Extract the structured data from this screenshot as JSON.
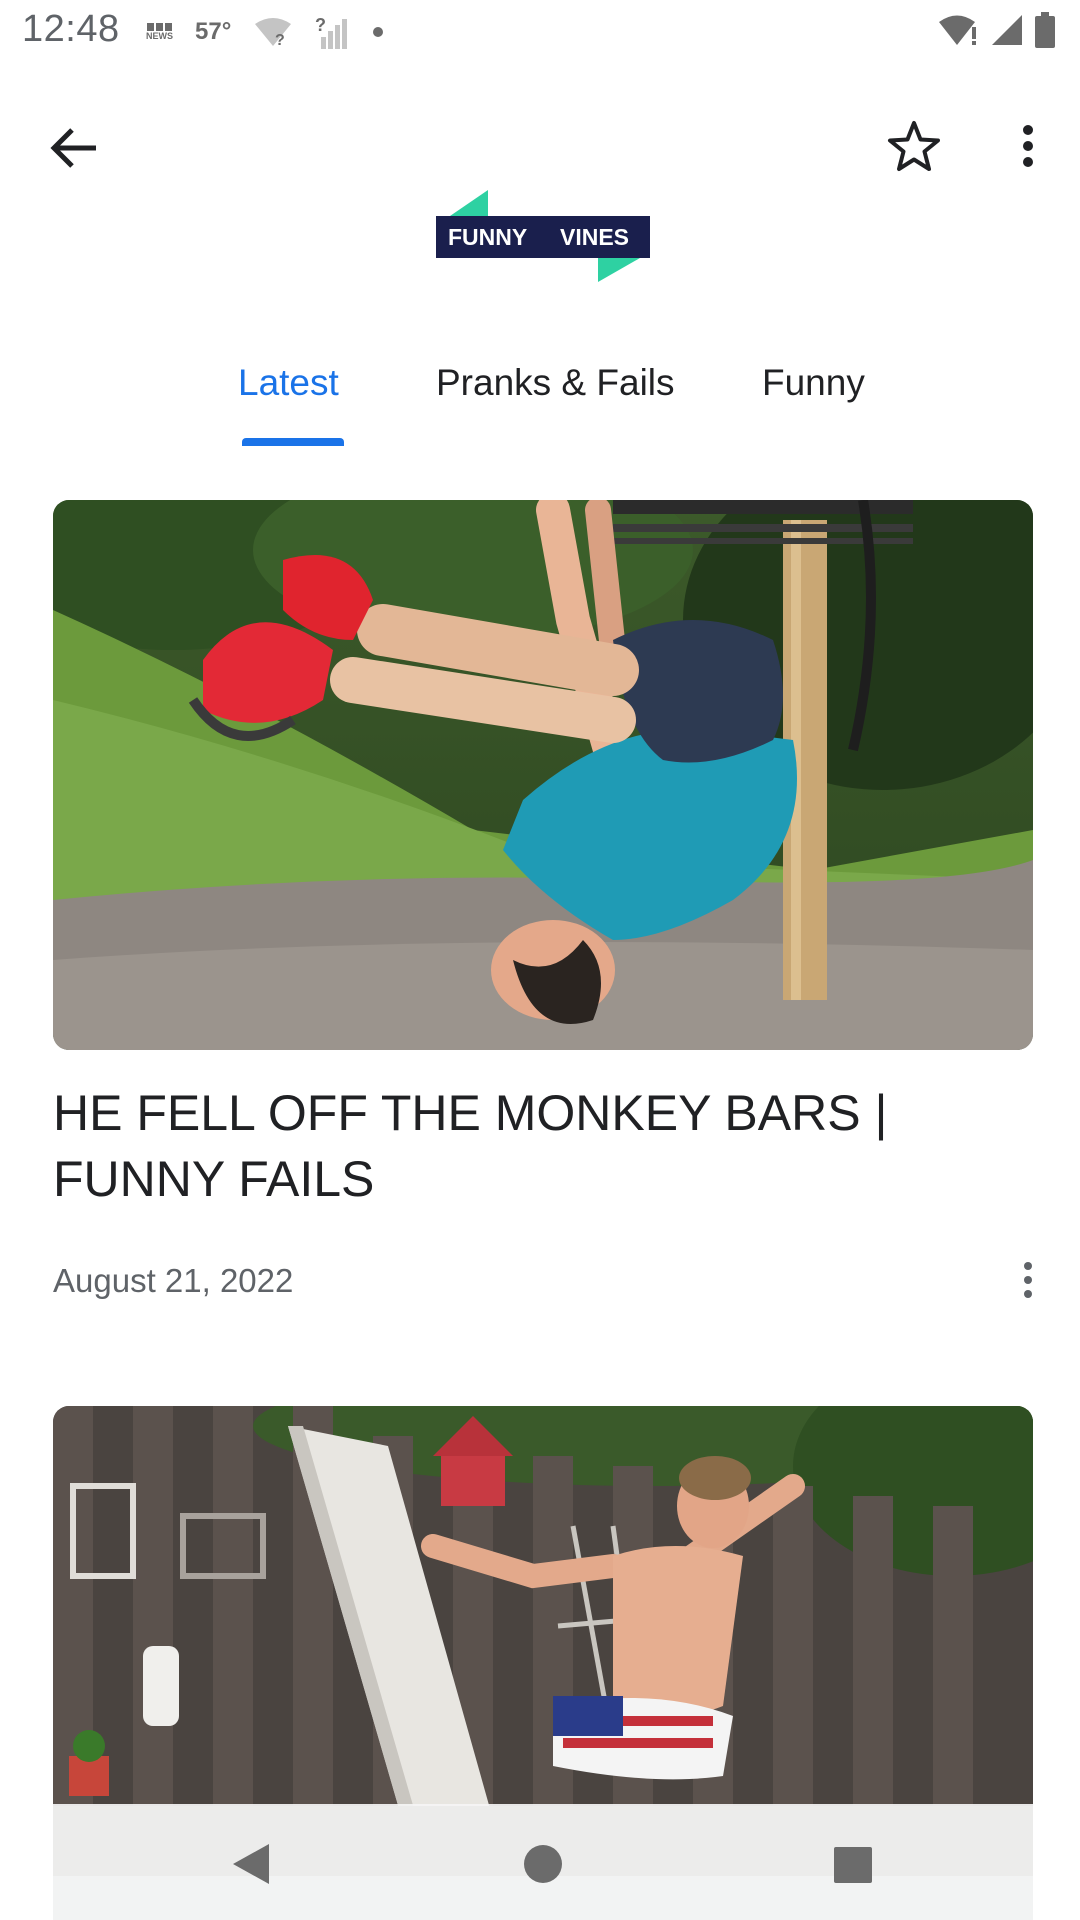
{
  "status_bar": {
    "time": "12:48",
    "bbc_label": "NEWS",
    "temperature": "57°",
    "icons": [
      "bbc-news-icon",
      "wifi-question-icon",
      "signal-question-icon",
      "notification-dot-icon",
      "wifi-alert-icon",
      "cellular-signal-icon",
      "battery-icon"
    ]
  },
  "app_bar": {
    "back_icon": "arrow-back-icon",
    "bookmark_icon": "star-outline-icon",
    "more_icon": "more-vert-icon"
  },
  "logo": {
    "word1": "FUNNY",
    "word2": "VINES",
    "colors": {
      "banner": "#1a1f4d",
      "accent": "#2ed1a2"
    }
  },
  "tabs": [
    {
      "label": "Latest",
      "active": true
    },
    {
      "label": "Pranks & Fails",
      "active": false
    },
    {
      "label": "Funny",
      "active": false
    }
  ],
  "articles": [
    {
      "thumbnail": "man-falling-off-monkey-bars-photo",
      "title": "HE FELL OFF THE MONKEY BARS | FUNNY FAILS",
      "date": "August 21, 2022"
    },
    {
      "thumbnail": "man-diving-board-backyard-pool-photo"
    }
  ],
  "nav_bar": {
    "icons": [
      "nav-back-icon",
      "nav-home-icon",
      "nav-recents-icon"
    ]
  },
  "colors": {
    "accent": "#1a73e8",
    "text_primary": "#202124",
    "text_secondary": "#5f6368"
  }
}
